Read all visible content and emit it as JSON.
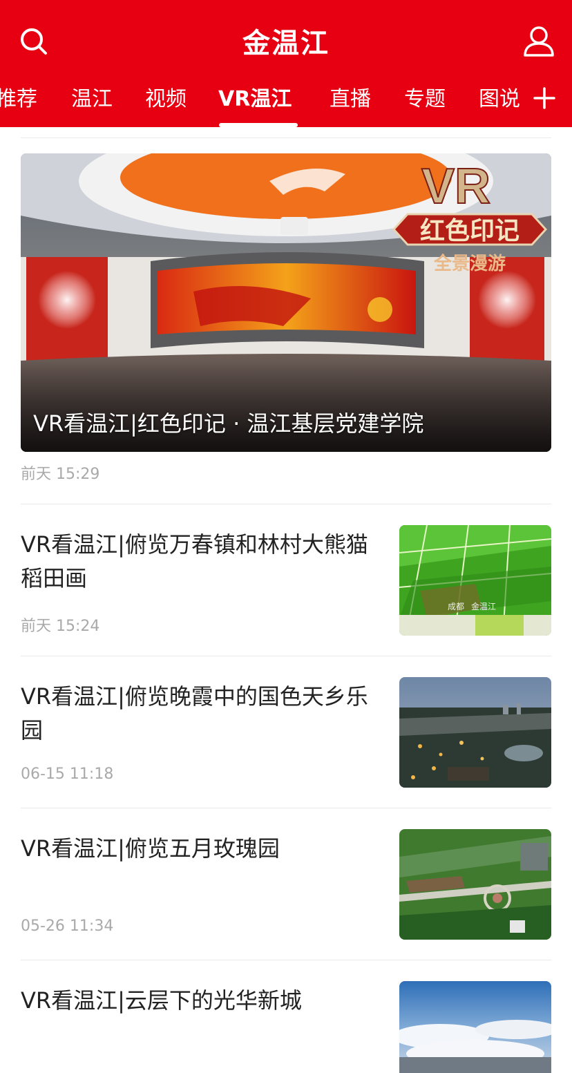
{
  "header": {
    "title": "金温江",
    "brand_color": "#e60012",
    "search_icon": "search-icon",
    "user_icon": "user-icon"
  },
  "tabs": [
    {
      "label": "推荐"
    },
    {
      "label": "温江"
    },
    {
      "label": "视频"
    },
    {
      "label": "VR温江",
      "active": true
    },
    {
      "label": "直播"
    },
    {
      "label": "专题"
    },
    {
      "label": "图说"
    }
  ],
  "tab_add_icon": "plus-icon",
  "hero": {
    "caption": "VR看温江|红色印记 · 温江基层党建学院",
    "time": "前天 15:29",
    "badge_vr": "VR",
    "badge_line1": "红色印记",
    "badge_line2": "全景漫游"
  },
  "items": [
    {
      "title": "VR看温江|俯览万春镇和林村大熊猫稻田画",
      "time": "前天 15:24",
      "thumb_text1": "成都",
      "thumb_text2": "金温江"
    },
    {
      "title": "VR看温江|俯览晚霞中的国色天乡乐园",
      "time": "06-15 11:18"
    },
    {
      "title": "VR看温江|俯览五月玫瑰园",
      "time": "05-26 11:34"
    },
    {
      "title": "VR看温江|云层下的光华新城",
      "time": ""
    }
  ]
}
